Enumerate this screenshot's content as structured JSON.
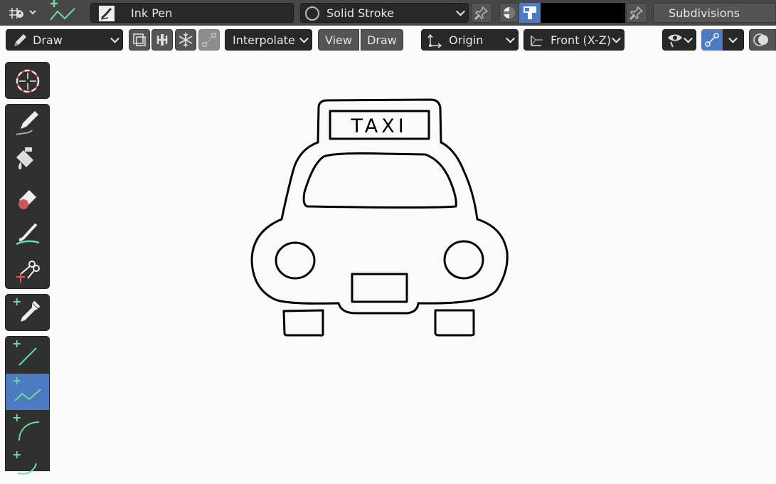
{
  "header": {
    "material_name": "Ink Pen",
    "stroke_mode": "Solid Stroke",
    "right_label": "Subdivisions"
  },
  "toolbar": {
    "mode": "Draw",
    "interpolate": "Interpolate",
    "view_tab": "View",
    "draw_tab": "Draw",
    "origin": "Origin",
    "projection": "Front (X-Z)"
  },
  "tools": [
    "cursor",
    "draw",
    "fill",
    "erase",
    "tint",
    "cutter",
    "eyedropper",
    "line",
    "polyline",
    "arc",
    "curve"
  ],
  "active_tool": "polyline",
  "canvas": {
    "sign_text": "TAXI"
  },
  "colors": {
    "accent": "#4d7ac0",
    "plus_green": "#6cdca2",
    "header_bg": "#474747",
    "canvas_bg": "#fafafa",
    "stroke_black": "#000000"
  }
}
